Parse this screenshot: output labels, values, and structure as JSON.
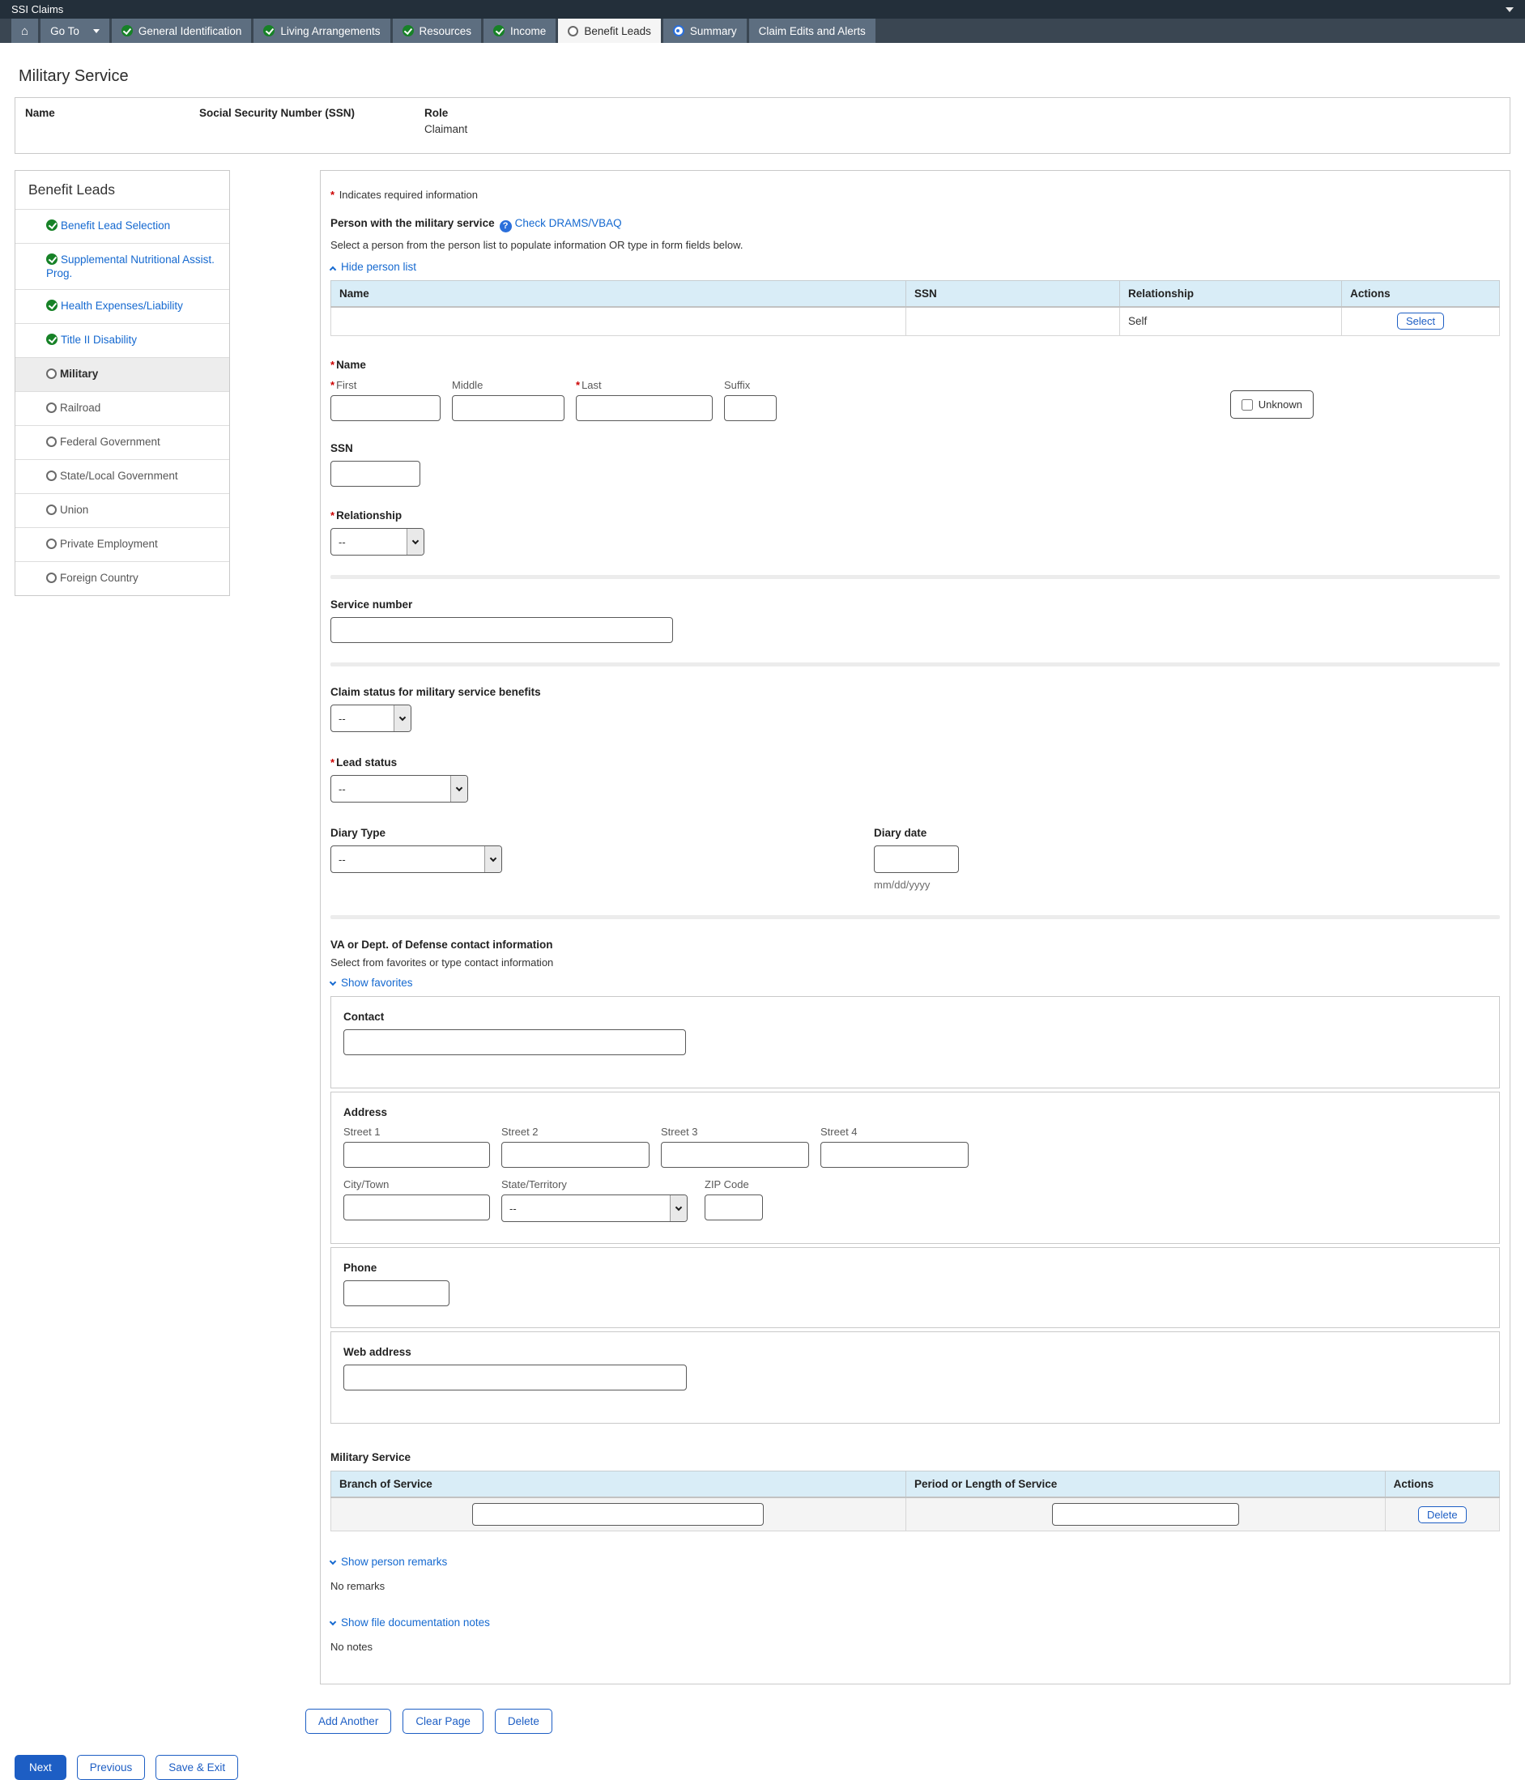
{
  "colors": {
    "accent_blue": "#1d5ec4",
    "link_blue": "#1569d0",
    "complete_green": "#178227",
    "nav_bar_bg": "#3a4652",
    "nav_button_bg": "#5d6e80",
    "table_header_bg": "#d9edf7",
    "required_red": "#cc0000"
  },
  "title_bar": {
    "title": "SSI Claims"
  },
  "nav": {
    "go_to": "Go To",
    "tabs": [
      {
        "label": "General Identification",
        "state": "complete"
      },
      {
        "label": "Living Arrangements",
        "state": "complete"
      },
      {
        "label": "Resources",
        "state": "complete"
      },
      {
        "label": "Income",
        "state": "complete"
      },
      {
        "label": "Benefit Leads",
        "state": "current"
      },
      {
        "label": "Summary",
        "state": "active"
      },
      {
        "label": "Claim Edits and Alerts",
        "state": "plain"
      }
    ]
  },
  "page": {
    "title": "Military Service"
  },
  "claimant_header": {
    "name_label": "Name",
    "ssn_label": "Social Security Number (SSN)",
    "role_label": "Role",
    "role_value": "Claimant"
  },
  "sidebar": {
    "title": "Benefit Leads",
    "items": [
      {
        "label": "Benefit Lead Selection",
        "state": "complete"
      },
      {
        "label": "Supplemental Nutritional Assist. Prog.",
        "state": "complete"
      },
      {
        "label": "Health Expenses/Liability",
        "state": "complete"
      },
      {
        "label": "Title II Disability",
        "state": "complete"
      },
      {
        "label": "Military",
        "state": "current"
      },
      {
        "label": "Railroad",
        "state": "pending"
      },
      {
        "label": "Federal Government",
        "state": "pending"
      },
      {
        "label": "State/Local Government",
        "state": "pending"
      },
      {
        "label": "Union",
        "state": "pending"
      },
      {
        "label": "Private Employment",
        "state": "pending"
      },
      {
        "label": "Foreign Country",
        "state": "pending"
      }
    ]
  },
  "form": {
    "required_marker": "*",
    "required_note": "Indicates required information",
    "person_picker": {
      "label": "Person with the military service",
      "help_icon": "?",
      "help_link": "Check DRAMS/VBAQ",
      "instruction": "Select a person from the person list to populate information OR type in form fields below.",
      "toggle_link": "Hide person list",
      "table": {
        "headers": [
          "Name",
          "SSN",
          "Relationship",
          "Actions"
        ],
        "row": {
          "name": "",
          "ssn": "",
          "relationship": "Self",
          "action_label": "Select"
        }
      }
    },
    "name": {
      "label": "Name",
      "first": "First",
      "middle": "Middle",
      "last": "Last",
      "suffix": "Suffix",
      "unknown": "Unknown"
    },
    "ssn_label": "SSN",
    "relationship": {
      "label": "Relationship",
      "value": "--"
    },
    "service_number_label": "Service number",
    "claim_status": {
      "label": "Claim status for military service benefits",
      "value": "--"
    },
    "lead_status": {
      "label": "Lead status",
      "value": "--"
    },
    "diary": {
      "type_label": "Diary Type",
      "type_value": "--",
      "date_label": "Diary date",
      "date_format": "mm/dd/yyyy"
    },
    "va_contact": {
      "title": "VA or Dept. of Defense contact information",
      "instruction": "Select from favorites or type contact information",
      "favorites_link": "Show favorites",
      "contact_label": "Contact",
      "address": {
        "label": "Address",
        "street1": "Street 1",
        "street2": "Street 2",
        "street3": "Street 3",
        "street4": "Street 4",
        "city": "City/Town",
        "state": "State/Territory",
        "state_value": "--",
        "zip": "ZIP Code"
      },
      "phone_label": "Phone",
      "web_label": "Web address"
    },
    "military_table": {
      "title": "Military Service",
      "headers": [
        "Branch of Service",
        "Period or Length of Service",
        "Actions"
      ],
      "delete_label": "Delete"
    },
    "remarks": {
      "toggle_link": "Show person remarks",
      "empty_text": "No remarks"
    },
    "notes": {
      "toggle_link": "Show file documentation notes",
      "empty_text": "No notes"
    },
    "actions": {
      "add_another": "Add Another",
      "clear_page": "Clear Page",
      "delete": "Delete"
    }
  },
  "footer": {
    "next": "Next",
    "previous": "Previous",
    "save_exit": "Save & Exit"
  }
}
